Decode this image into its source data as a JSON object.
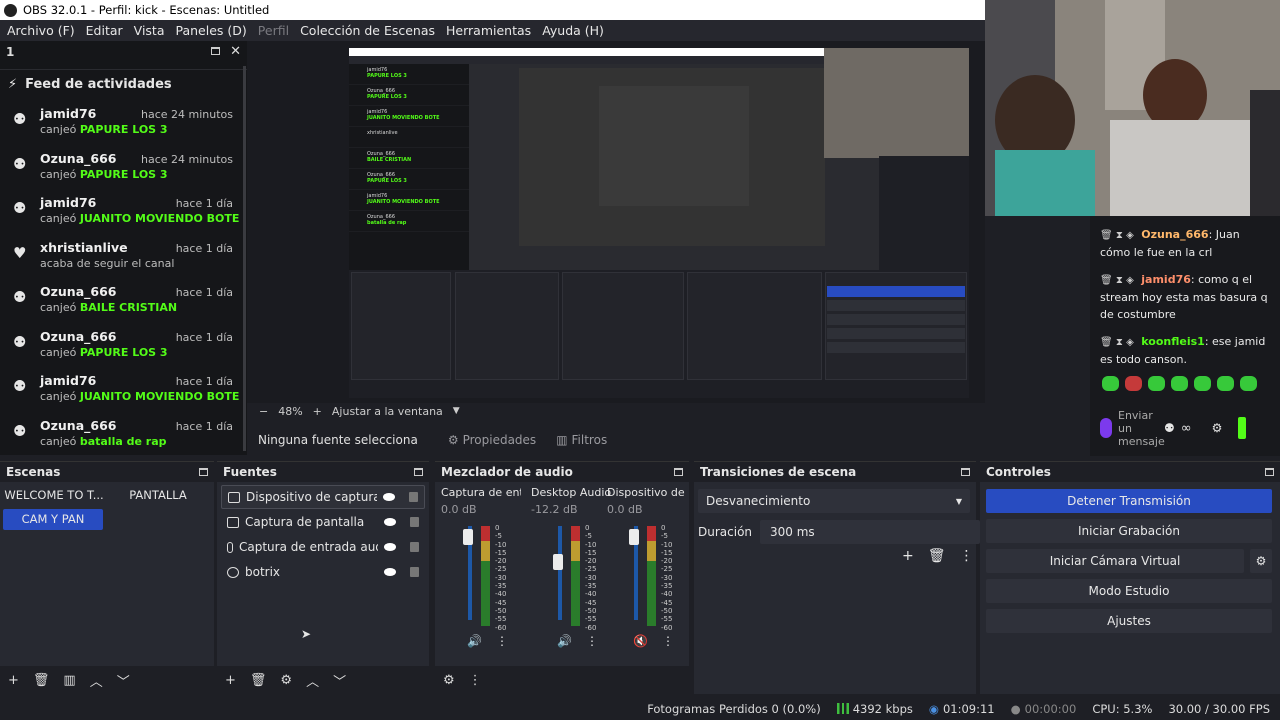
{
  "window": {
    "title": "OBS 32.0.1 - Perfil: kick - Escenas: Untitled"
  },
  "menu": [
    "Archivo (F)",
    "Editar",
    "Vista",
    "Paneles (D)",
    "Perfil",
    "Colección de Escenas",
    "Herramientas",
    "Ayuda (H)"
  ],
  "activity_dock": {
    "dock_title": "1",
    "feed_title": "Feed de actividades",
    "items": [
      {
        "user": "jamid76",
        "time": "hace 24 minutos",
        "action": "canjeó",
        "reward": "PAPURE LOS 3"
      },
      {
        "user": "Ozuna_666",
        "time": "hace 24 minutos",
        "action": "canjeó",
        "reward": "PAPURE LOS 3"
      },
      {
        "user": "jamid76",
        "time": "hace 1 día",
        "action": "canjeó",
        "reward": "JUANITO MOVIENDO BOTE"
      },
      {
        "user": "xhristianlive",
        "time": "hace 1 día",
        "action": "acaba de seguir el canal",
        "reward": ""
      },
      {
        "user": "Ozuna_666",
        "time": "hace 1 día",
        "action": "canjeó",
        "reward": "BAILE CRISTIAN"
      },
      {
        "user": "Ozuna_666",
        "time": "hace 1 día",
        "action": "canjeó",
        "reward": "PAPURE LOS 3"
      },
      {
        "user": "jamid76",
        "time": "hace 1 día",
        "action": "canjeó",
        "reward": "JUANITO MOVIENDO BOTE"
      },
      {
        "user": "Ozuna_666",
        "time": "hace 1 día",
        "action": "canjeó",
        "reward": "batalla de rap"
      }
    ]
  },
  "chat": {
    "messages": [
      {
        "user": "Ozuna_666",
        "text": "Juan cómo le fue en la crl"
      },
      {
        "user": "jamid76",
        "text": "como q el stream hoy esta mas basura q de costumbre"
      },
      {
        "user": "koonfleis1",
        "text": "ese jamid es todo canson."
      }
    ],
    "input_placeholder": "Enviar un mensaje"
  },
  "preview": {
    "zoom": "48%",
    "fit_label": "Ajustar a la ventana",
    "no_source": "Ninguna fuente selecciona",
    "properties": "Propiedades",
    "filters": "Filtros"
  },
  "scenes": {
    "title": "Escenas",
    "items": [
      "WELCOME TO T...",
      "PANTALLA",
      "CAM Y PAN"
    ],
    "selected": "CAM Y PAN"
  },
  "sources": {
    "title": "Fuentes",
    "items": [
      "Dispositivo de captura de v",
      "Captura de pantalla",
      "Captura de entrada audio",
      "botrix"
    ]
  },
  "mixer": {
    "title": "Mezclador de audio",
    "channels": [
      {
        "name": "Captura de entrada",
        "db": "0.0 dB",
        "level": 0.97,
        "muted": false
      },
      {
        "name": "Desktop Audio",
        "db": "-12.2 dB",
        "level": 0.7,
        "muted": false
      },
      {
        "name": "Dispositivo de capt",
        "db": "0.0 dB",
        "level": 0.97,
        "muted": true
      }
    ],
    "scale": [
      "0",
      "-5",
      "-10",
      "-15",
      "-20",
      "-25",
      "-30",
      "-35",
      "-40",
      "-45",
      "-50",
      "-55",
      "-60"
    ]
  },
  "transitions": {
    "title": "Transiciones de escena",
    "selected": "Desvanecimiento",
    "duration_label": "Duración",
    "duration_value": "300 ms"
  },
  "controls": {
    "title": "Controles",
    "buttons": [
      "Detener Transmisión",
      "Iniciar Grabación",
      "Iniciar Cámara Virtual",
      "Modo Estudio",
      "Ajustes"
    ]
  },
  "status": {
    "dropped": "Fotogramas Perdidos 0 (0.0%)",
    "bitrate": "4392 kbps",
    "stream_time": "01:09:11",
    "rec_time": "00:00:00",
    "cpu": "CPU: 5.3%",
    "fps": "30.00 / 30.00 FPS"
  },
  "colors": {
    "accent": "#284cc1",
    "kick_green": "#53fc18",
    "bg": "#1e1f25"
  }
}
